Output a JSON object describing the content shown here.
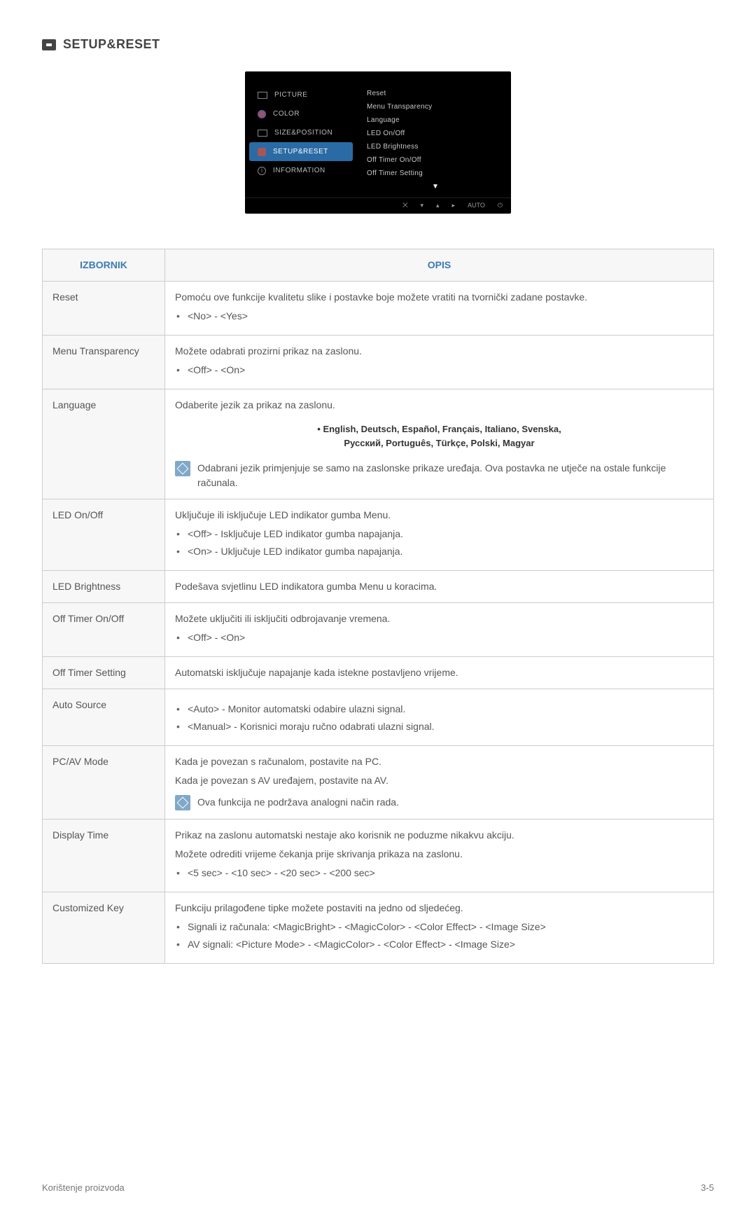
{
  "section_title": "SETUP&RESET",
  "osd": {
    "categories": [
      {
        "label": "PICTURE",
        "iconClass": "mi"
      },
      {
        "label": "COLOR",
        "iconClass": "mi c"
      },
      {
        "label": "SIZE&POSITION",
        "iconClass": "mi s"
      },
      {
        "label": "SETUP&RESET",
        "iconClass": "mi g",
        "active": true
      },
      {
        "label": "INFORMATION",
        "iconClass": "mi i"
      }
    ],
    "items": [
      "Reset",
      "Menu Transparency",
      "Language",
      "LED On/Off",
      "LED Brightness",
      "Off Timer On/Off",
      "Off Timer Setting"
    ],
    "footer": [
      "⨉",
      "▾",
      "▴",
      "▸",
      "AUTO",
      "⏻"
    ]
  },
  "table": {
    "headers": {
      "menu": "IZBORNIK",
      "desc": "OPIS"
    },
    "rows": {
      "reset": {
        "key": "Reset",
        "line1": "Pomoću ove funkcije kvalitetu slike i postavke boje možete vratiti na tvornički zadane postavke.",
        "bullets": [
          "<No> - <Yes>"
        ]
      },
      "menu_transparency": {
        "key": "Menu Transparency",
        "line1": "Možete odabrati prozirni prikaz na zaslonu.",
        "bullets": [
          "<Off> - <On>"
        ]
      },
      "language": {
        "key": "Language",
        "line1": "Odaberite jezik za prikaz na zaslonu.",
        "langs_line1": "• English, Deutsch, Español, Français, Italiano, Svenska,",
        "langs_line2": "Русский, Português, Türkçe, Polski, Magyar",
        "note": "Odabrani jezik primjenjuje se samo na zaslonske prikaze uređaja. Ova postavka ne utječe na ostale funkcije računala."
      },
      "led_onoff": {
        "key": "LED On/Off",
        "line1": "Uključuje ili isključuje LED indikator gumba Menu.",
        "bullets": [
          "<Off> - Isključuje LED indikator gumba napajanja.",
          "<On> - Uključuje LED indikator gumba napajanja."
        ]
      },
      "led_brightness": {
        "key": "LED Brightness",
        "line1": "Podešava svjetlinu LED indikatora gumba Menu u koracima."
      },
      "off_timer_onoff": {
        "key": "Off Timer On/Off",
        "line1": "Možete uključiti ili isključiti odbrojavanje vremena.",
        "bullets": [
          "<Off> - <On>"
        ]
      },
      "off_timer_setting": {
        "key": "Off Timer Setting",
        "line1": "Automatski isključuje napajanje kada istekne postavljeno vrijeme."
      },
      "auto_source": {
        "key": "Auto Source",
        "bullets": [
          "<Auto> - Monitor automatski odabire ulazni signal.",
          "<Manual> - Korisnici moraju ručno odabrati ulazni signal."
        ]
      },
      "pcav": {
        "key": "PC/AV Mode",
        "line1": "Kada je povezan s računalom, postavite na PC.",
        "line2": "Kada je povezan s AV uređajem, postavite na AV.",
        "note": "Ova funkcija ne podržava analogni način rada."
      },
      "display_time": {
        "key": "Display Time",
        "line1": "Prikaz na zaslonu automatski nestaje ako korisnik ne poduzme nikakvu akciju.",
        "line2": "Možete odrediti vrijeme čekanja prije skrivanja prikaza na zaslonu.",
        "bullets": [
          "<5 sec> - <10 sec> - <20 sec> - <200 sec>"
        ]
      },
      "customized_key": {
        "key": "Customized Key",
        "line1": "Funkciju prilagođene tipke možete postaviti na jedno od sljedećeg.",
        "bullets": [
          "Signali iz računala: <MagicBright> - <MagicColor> - <Color Effect> - <Image Size>",
          "AV signali: <Picture Mode> - <MagicColor> - <Color Effect> - <Image Size>"
        ]
      }
    }
  },
  "footer": {
    "left": "Korištenje proizvoda",
    "right": "3-5"
  }
}
